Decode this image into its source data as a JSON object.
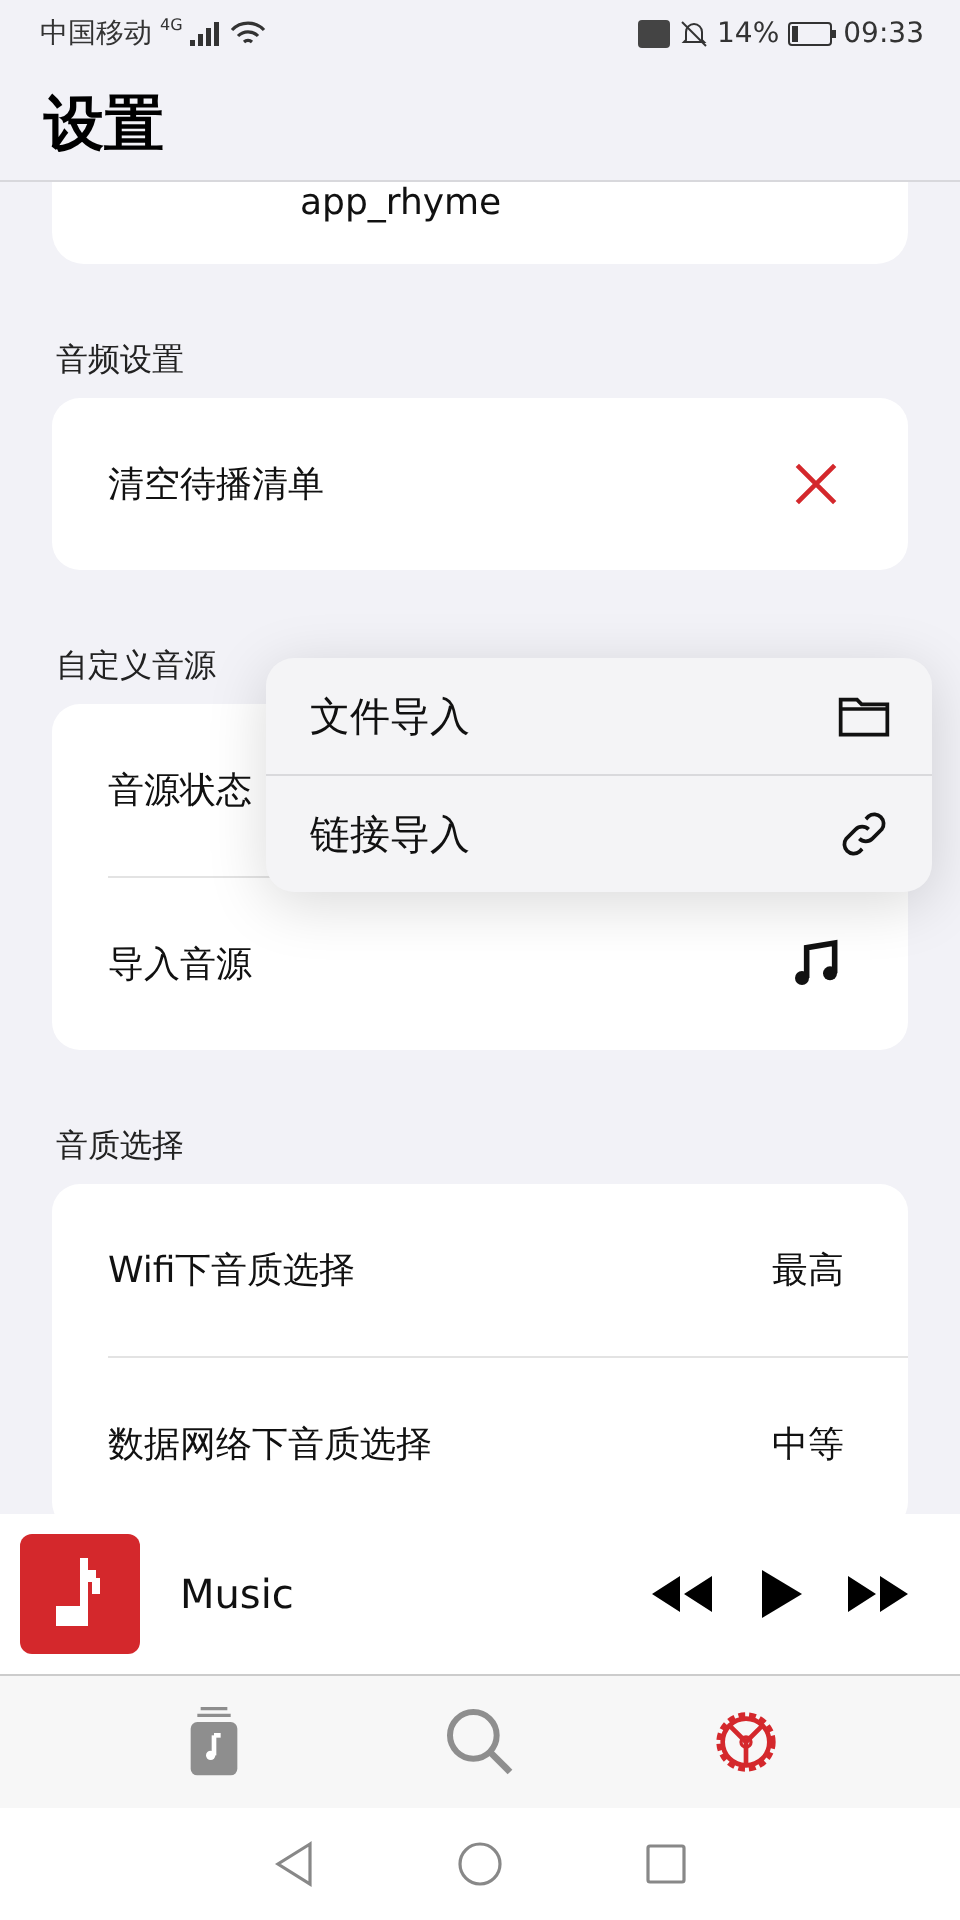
{
  "status_bar": {
    "carrier": "中国移动",
    "network": "4G",
    "battery": "14%",
    "time": "09:33"
  },
  "header": {
    "title": "设置"
  },
  "top_card": {
    "value": "app_rhyme"
  },
  "sections": [
    {
      "title": "音频设置",
      "rows": [
        {
          "label": "清空待播清单",
          "kind": "clear"
        }
      ]
    },
    {
      "title": "自定义音源",
      "rows": [
        {
          "label": "音源状态",
          "kind": "plain"
        },
        {
          "label": "导入音源",
          "kind": "music"
        }
      ]
    },
    {
      "title": "音质选择",
      "rows": [
        {
          "label": "Wifi下音质选择",
          "kind": "value",
          "value": "最高"
        },
        {
          "label": "数据网络下音质选择",
          "kind": "value",
          "value": "中等"
        }
      ]
    }
  ],
  "popup_menu": [
    {
      "label": "文件导入",
      "kind": "folder"
    },
    {
      "label": "链接导入",
      "kind": "link"
    }
  ],
  "player": {
    "title": "Music"
  },
  "tabs": [
    {
      "kind": "library",
      "selected": false
    },
    {
      "kind": "search",
      "selected": false
    },
    {
      "kind": "settings",
      "selected": true
    }
  ]
}
